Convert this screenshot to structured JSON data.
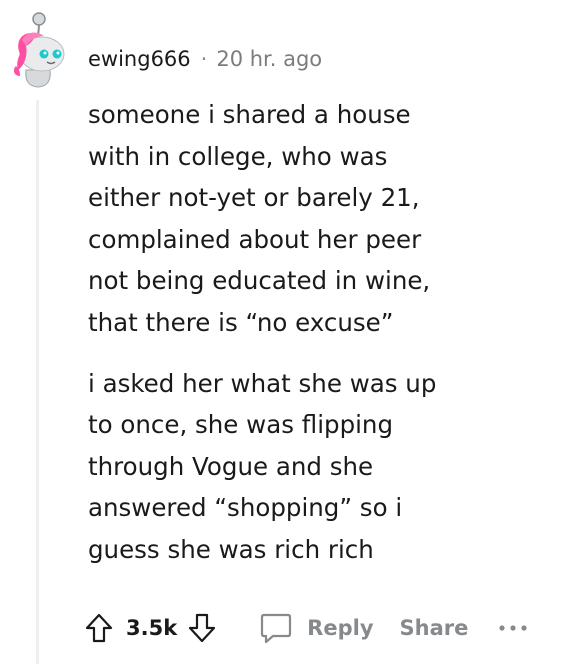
{
  "comment": {
    "author": "ewing666",
    "separator": "·",
    "timestamp": "20 hr. ago",
    "paragraphs": [
      "someone i shared a house\nwith in college, who was\neither not-yet or barely 21,\ncomplained about her peer\nnot being educated in wine,\nthat there is “no excuse”",
      "i asked her what she was up\nto once, she was flipping\nthrough Vogue and she\nanswered “shopping” so i\nguess she was rich rich"
    ]
  },
  "actions": {
    "score": "3.5k",
    "reply_label": "Reply",
    "share_label": "Share"
  },
  "icons": {
    "avatar": "snoo-avatar-pink-hair",
    "upvote": "arrow-up-icon",
    "downvote": "arrow-down-icon",
    "reply": "speech-bubble-icon",
    "more": "ellipsis-icon"
  },
  "colors": {
    "text": "#1a1a1b",
    "muted": "#878a8c",
    "thread_line": "#edeff1",
    "avatar_hair": "#ff4fa3",
    "avatar_eyes": "#1ec9c9"
  }
}
